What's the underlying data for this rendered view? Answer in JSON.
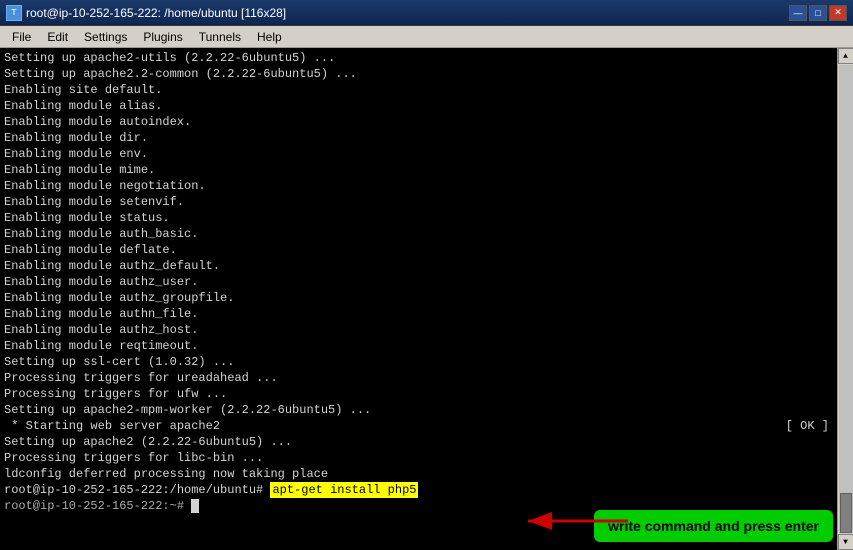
{
  "titlebar": {
    "title": "root@ip-10-252-165-222: /home/ubuntu [116x28]",
    "icon": "T"
  },
  "window_controls": {
    "minimize": "—",
    "maximize": "□",
    "close": "✕"
  },
  "menubar": {
    "items": [
      "File",
      "Edit",
      "Settings",
      "Plugins",
      "Tunnels",
      "Help"
    ]
  },
  "terminal": {
    "lines": [
      "Setting up apache2-utils (2.2.22-6ubuntu5) ...",
      "Setting up apache2.2-common (2.2.22-6ubuntu5) ...",
      "Enabling site default.",
      "Enabling module alias.",
      "Enabling module autoindex.",
      "Enabling module dir.",
      "Enabling module env.",
      "Enabling module mime.",
      "Enabling module negotiation.",
      "Enabling module setenvif.",
      "Enabling module status.",
      "Enabling module auth_basic.",
      "Enabling module deflate.",
      "Enabling module authz_default.",
      "Enabling module authz_user.",
      "Enabling module authz_groupfile.",
      "Enabling module authn_file.",
      "Enabling module authz_host.",
      "Enabling module reqtimeout.",
      "Setting up ssl-cert (1.0.32) ...",
      "Processing triggers for ureadahead ...",
      "Processing triggers for ufw ...",
      "Setting up apache2-mpm-worker (2.2.22-6ubuntu5) ...",
      " * Starting web server apache2",
      "Setting up apache2 (2.2.22-6ubuntu5) ...",
      "Processing triggers for libc-bin ...",
      "ldconfig deferred processing now taking place"
    ],
    "ok_text": "[ OK ]",
    "prompt": "root@ip-10-252-165-222:/home/ubuntu#",
    "command": "apt-get install php5",
    "last_line": "root@ip-10-252-165-222:~#"
  },
  "annotation": {
    "text": "write command and press enter"
  }
}
